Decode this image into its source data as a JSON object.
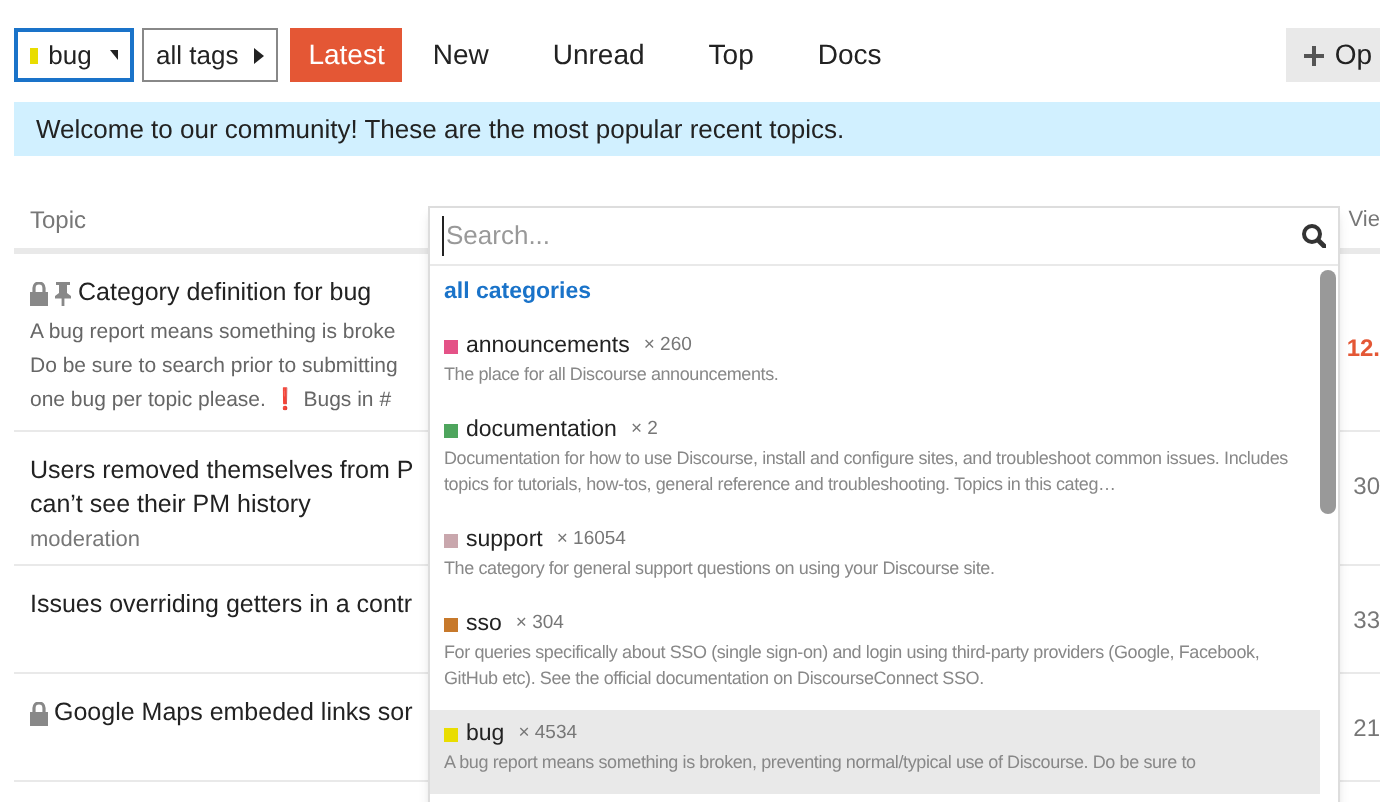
{
  "nav": {
    "category_filter": {
      "label": "bug",
      "color": "#e9dd00"
    },
    "tag_filter": {
      "label": "all tags"
    },
    "tabs": [
      {
        "label": "Latest",
        "selected": true
      },
      {
        "label": "New",
        "selected": false
      },
      {
        "label": "Unread",
        "selected": false
      },
      {
        "label": "Top",
        "selected": false
      },
      {
        "label": "Docs",
        "selected": false
      }
    ],
    "new_topic_button": {
      "label": "Op"
    }
  },
  "banner": "Welcome to our community! These are the most popular recent topics.",
  "topic_list": {
    "columns": [
      "Topic",
      "Vie"
    ],
    "rows": [
      {
        "locked": true,
        "pinned": true,
        "title": [
          "Category definition for bug"
        ],
        "excerpt": [
          "A bug report means something is broke",
          "Do be sure to search prior to submitting",
          "one bug per topic please. ❗ Bugs in #"
        ],
        "views": "12.",
        "hot": true
      },
      {
        "locked": false,
        "pinned": false,
        "title": [
          "Users removed themselves from P",
          "can’t see their PM history"
        ],
        "tag": "moderation",
        "views": "30",
        "hot": false
      },
      {
        "locked": false,
        "pinned": false,
        "title": [
          "Issues overriding getters in a contr"
        ],
        "views": "33",
        "hot": false
      },
      {
        "locked": true,
        "pinned": false,
        "title": [
          "Google Maps embeded links sor"
        ],
        "views": "21",
        "hot": false
      }
    ]
  },
  "category_dropdown": {
    "search": {
      "placeholder": "Search..."
    },
    "all_label": "all categories",
    "items": [
      {
        "name": "announcements",
        "count": "× 260",
        "color": "#e45287",
        "description": "The place for all Discourse announcements.",
        "selected": false
      },
      {
        "name": "documentation",
        "count": "× 2",
        "color": "#4ea55d",
        "description": "Documentation for how to use Discourse, install and configure sites, and troubleshoot common issues. Includes topics for tutorials, how-tos, general reference and troubleshooting. Topics in this categ…",
        "selected": false
      },
      {
        "name": "support",
        "count": "× 16054",
        "color": "#c9a7ad",
        "description": "The category for general support questions on using your Discourse site.",
        "selected": false
      },
      {
        "name": "sso",
        "count": "× 304",
        "color": "#c7792b",
        "description": "For queries specifically about SSO (single sign-on) and login using third-party providers (Google, Facebook, GitHub etc). See the official documentation on DiscourseConnect SSO.",
        "selected": false
      },
      {
        "name": "bug",
        "count": "× 4534",
        "color": "#e9dd00",
        "description": "A bug report means something is broken, preventing normal/typical use of Discourse. Do be sure to",
        "selected": true
      }
    ]
  }
}
